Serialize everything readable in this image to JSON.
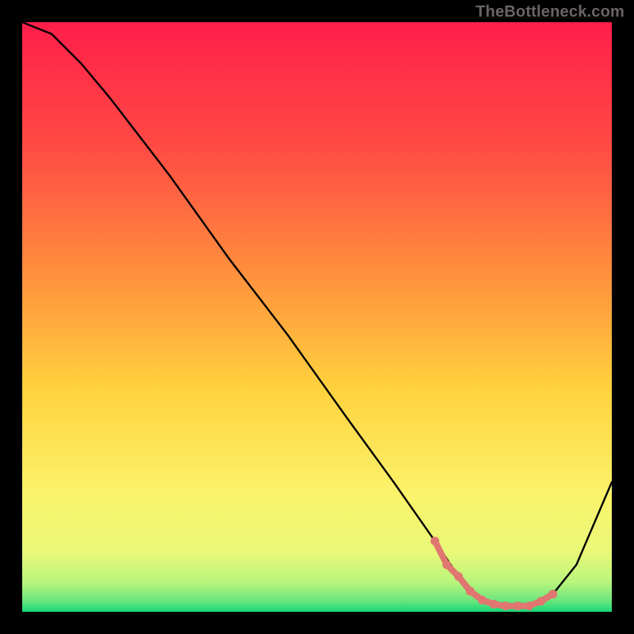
{
  "watermark": "TheBottleneck.com",
  "chart_data": {
    "type": "line",
    "title": "",
    "xlabel": "",
    "ylabel": "",
    "xlim": [
      0,
      100
    ],
    "ylim": [
      0,
      100
    ],
    "grid": false,
    "background_gradient": {
      "top": "#ff1e4a",
      "mid_upper": "#ff7d3f",
      "mid": "#ffd23f",
      "mid_lower": "#f9f56a",
      "near_bottom": "#d9f97a",
      "bottom": "#17d877"
    },
    "series": [
      {
        "name": "bottleneck-curve",
        "color": "#000000",
        "x": [
          0,
          5,
          10,
          15,
          25,
          35,
          45,
          55,
          63,
          70,
          74,
          78,
          82,
          86,
          90,
          94,
          100
        ],
        "y": [
          100,
          98,
          93,
          87,
          74,
          60,
          47,
          33,
          22,
          12,
          6,
          2,
          1,
          1,
          3,
          8,
          22
        ]
      }
    ],
    "highlight": {
      "name": "optimal-range",
      "color": "#e0766f",
      "points_x": [
        70,
        72,
        74,
        76,
        78,
        80,
        82,
        84,
        86,
        88,
        90
      ],
      "points_y": [
        12,
        8,
        6,
        3.5,
        2,
        1.3,
        1,
        1,
        1,
        1.8,
        3
      ]
    }
  }
}
